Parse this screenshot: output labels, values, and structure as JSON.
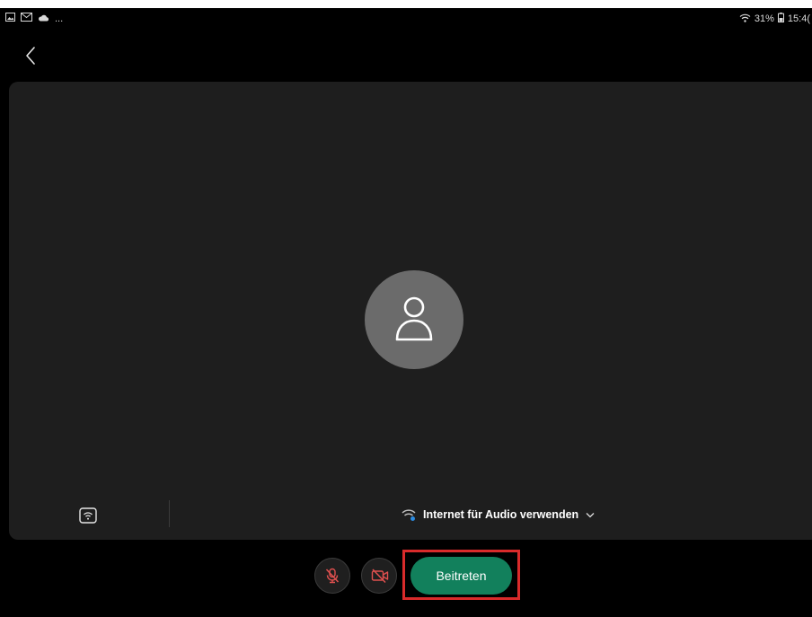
{
  "statusbar": {
    "left_icons": [
      "gallery-icon",
      "gmail-icon",
      "cloud-icon"
    ],
    "overflow": "...",
    "battery_percent": "31%",
    "time": "15:4("
  },
  "nav": {
    "back_icon": "chevron-left-icon"
  },
  "preview": {
    "avatar_icon": "person-icon",
    "cast_icon": "cast-wifi-icon",
    "audio_option": {
      "icon": "wifi-icon",
      "label": "Internet für Audio verwenden",
      "chevron": "chevron-down-icon"
    }
  },
  "controls": {
    "mute_icon": "mic-off-icon",
    "video_icon": "video-off-icon",
    "join_label": "Beitreten"
  },
  "colors": {
    "background": "#000000",
    "preview_panel": "#1e1e1e",
    "avatar": "#6b6b6b",
    "join_button": "#12805c",
    "muted_red": "#e0504f",
    "highlight": "#d92b2b"
  }
}
